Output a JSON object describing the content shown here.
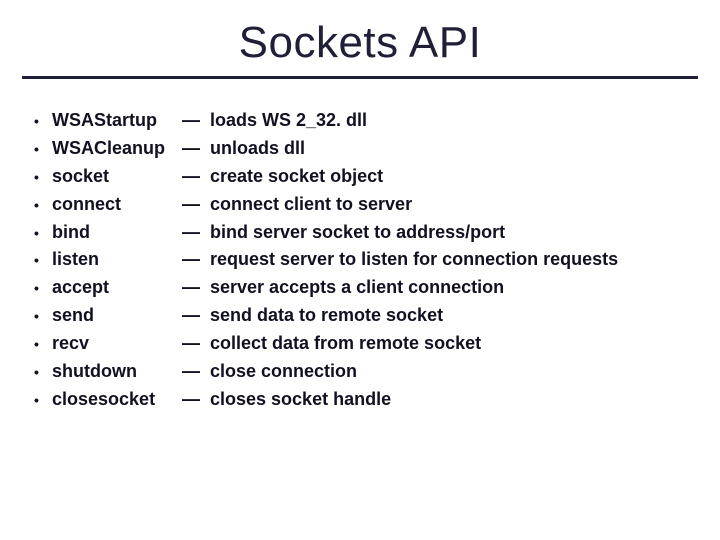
{
  "title": "Sockets API",
  "items": [
    {
      "fn": "WSAStartup",
      "desc": "loads WS 2_32. dll"
    },
    {
      "fn": "WSACleanup",
      "desc": "unloads dll"
    },
    {
      "fn": "socket",
      "desc": "create socket object"
    },
    {
      "fn": "connect",
      "desc": "connect client to server"
    },
    {
      "fn": "bind",
      "desc": "bind server socket to address/port"
    },
    {
      "fn": "listen",
      "desc": "request server to listen for connection requests"
    },
    {
      "fn": "accept",
      "desc": "server accepts a client connection"
    },
    {
      "fn": "send",
      "desc": "send data to remote socket"
    },
    {
      "fn": "recv",
      "desc": "collect data from remote socket"
    },
    {
      "fn": "shutdown",
      "desc": "close connection"
    },
    {
      "fn": "closesocket",
      "desc": "closes socket handle"
    }
  ],
  "glyphs": {
    "bullet": "•",
    "dash": "—"
  }
}
